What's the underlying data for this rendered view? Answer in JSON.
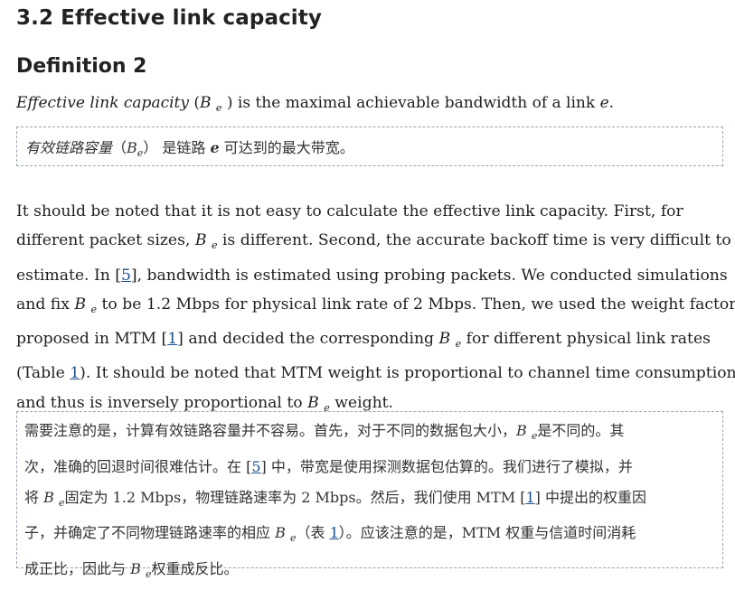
{
  "section_title": "3.2 Effective link capacity",
  "definition_title": "Definition 2",
  "definition": {
    "term": "Effective link capacity",
    "open": " (",
    "symbol": "B",
    "symbol_sub": "e",
    "close": " ) is the maximal achievable bandwidth of a link ",
    "link_var": "e",
    "end": "."
  },
  "definition_zh": {
    "term": "有效链路容量",
    "open": "（",
    "symbol": "B",
    "symbol_sub": "e",
    "close": "） 是链路 ",
    "link_var": "e",
    "rest": " 可达到的最大带宽。"
  },
  "paragraph_en": {
    "l1": "It should be noted that it is not easy to calculate the effective link capacity. First, for",
    "l2a": "different packet sizes, ",
    "l2b": " is different. Second, the accurate backoff time is very difficult to",
    "l3a": "estimate. In [",
    "ref5": "5",
    "l3b": "], bandwidth is estimated using probing packets. We conducted simulations",
    "l4a": "and fix ",
    "l4b": " to be 1.2 Mbps for physical link rate of 2 Mbps. Then, we used the weight factors",
    "l5a": "proposed in MTM [",
    "ref1": "1",
    "l5b": "] and decided the corresponding ",
    "l5c": " for different physical link rates",
    "l6a": "(Table ",
    "table1": "1",
    "l6b": "). It should be noted that MTM weight is proportional to channel time consumption",
    "l7a": "and thus is inversely proportional to ",
    "l7b": " weight.",
    "sym": "B",
    "sym_sub": "e"
  },
  "paragraph_zh": {
    "l1a": "需要注意的是，计算有效链路容量并不容易。首先，对于不同的数据包大小，",
    "l1b": "是不同的。其",
    "l2a": "次，准确的回退时间很难估计。在 [",
    "ref5": "5",
    "l2b": "] 中，带宽是使用探测数据包估算的。我们进行了模拟，并",
    "l3a": "将 ",
    "l3b": "固定为 1.2 Mbps，物理链路速率为 2 Mbps。然后，我们使用 MTM [",
    "ref1": "1",
    "l3c": "] 中提出的权重因",
    "l4a": "子，并确定了不同物理链路速率的相应 ",
    "l4b": "（表 ",
    "table1": "1",
    "l4c": "）。应该注意的是，MTM 权重与信道时间消耗",
    "l5a": "成正比，因此与 ",
    "l5b": "权重成反比。",
    "sym": "B",
    "sym_sub": "e"
  }
}
